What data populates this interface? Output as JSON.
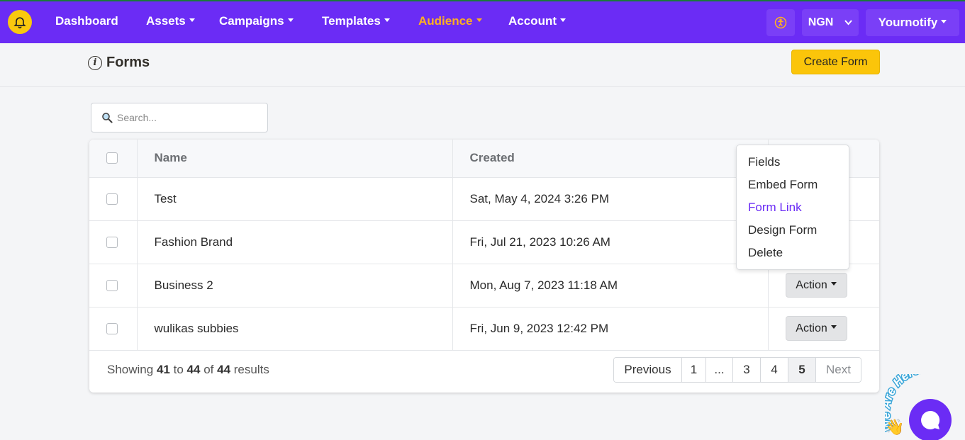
{
  "nav": {
    "items": [
      {
        "label": "Dashboard",
        "dropdown": false
      },
      {
        "label": "Assets",
        "dropdown": true
      },
      {
        "label": "Campaigns",
        "dropdown": true
      },
      {
        "label": "Templates",
        "dropdown": true
      },
      {
        "label": "Audience",
        "dropdown": true,
        "active": true
      },
      {
        "label": "Account",
        "dropdown": true
      }
    ],
    "accessibility_icon": "accessibility-icon",
    "currency": "NGN",
    "user": "Yournotify"
  },
  "header": {
    "title": "Forms",
    "create_label": "Create Form"
  },
  "search": {
    "placeholder": "Search..."
  },
  "table": {
    "columns": [
      "Name",
      "Created"
    ],
    "rows": [
      {
        "name": "Test",
        "created": "Sat, May 4, 2024 3:26 PM",
        "action": ""
      },
      {
        "name": "Fashion Brand",
        "created": "Fri, Jul 21, 2023 10:26 AM",
        "action": ""
      },
      {
        "name": "Business 2",
        "created": "Mon, Aug 7, 2023 11:18 AM",
        "action": "Action"
      },
      {
        "name": "wulikas subbies",
        "created": "Fri, Jun 9, 2023 12:42 PM",
        "action": "Action"
      }
    ]
  },
  "footer": {
    "showing": "Showing",
    "from": "41",
    "to_word": "to",
    "to": "44",
    "of_word": "of",
    "total": "44",
    "results_word": "results"
  },
  "pagination": [
    "Previous",
    "1",
    "...",
    "3",
    "4",
    "5",
    "Next"
  ],
  "dropdown": [
    "Fields",
    "Embed Form",
    "Form Link",
    "Design Form",
    "Delete"
  ],
  "chat": {
    "text": "We Are Here!"
  },
  "colors": {
    "brand": "#6b2cf5",
    "accent": "#fbc50a",
    "active_nav": "#ffb020"
  }
}
